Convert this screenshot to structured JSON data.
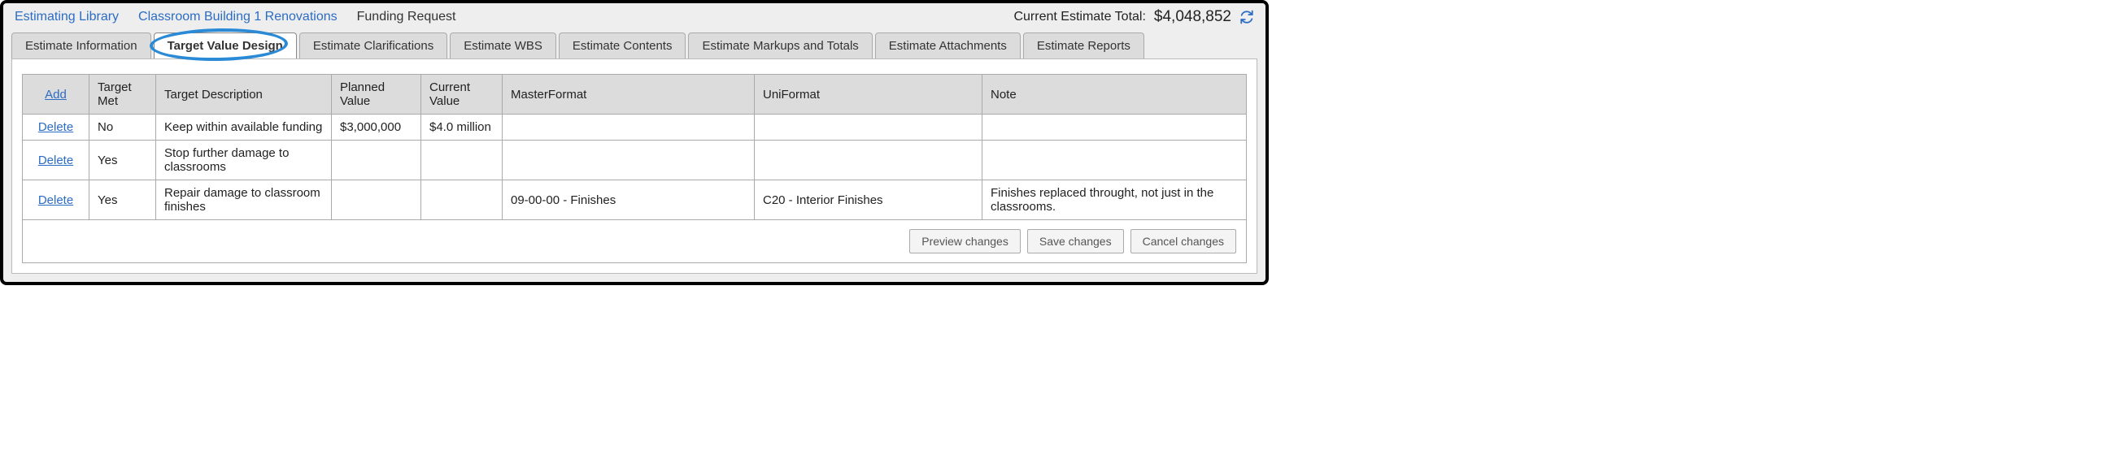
{
  "breadcrumbs": {
    "lib": "Estimating Library",
    "project": "Classroom Building 1 Renovations",
    "page": "Funding Request"
  },
  "total": {
    "label": "Current Estimate Total:",
    "value": "$4,048,852"
  },
  "tabs": [
    "Estimate Information",
    "Target Value Design",
    "Estimate Clarifications",
    "Estimate WBS",
    "Estimate Contents",
    "Estimate Markups and Totals",
    "Estimate Attachments",
    "Estimate Reports"
  ],
  "active_tab_index": 1,
  "table": {
    "headers": {
      "add": "Add",
      "target_met": "Target Met",
      "target_desc": "Target Description",
      "planned_value": "Planned Value",
      "current_value": "Current Value",
      "master": "MasterFormat",
      "uni": "UniFormat",
      "note": "Note"
    },
    "rows": [
      {
        "action": "Delete",
        "target_met": "No",
        "target_desc": "Keep within available funding",
        "planned_value": "$3,000,000",
        "current_value": "$4.0 million",
        "master": "",
        "uni": "",
        "note": ""
      },
      {
        "action": "Delete",
        "target_met": "Yes",
        "target_desc": "Stop further damage to classrooms",
        "planned_value": "",
        "current_value": "",
        "master": "",
        "uni": "",
        "note": ""
      },
      {
        "action": "Delete",
        "target_met": "Yes",
        "target_desc": "Repair damage to classroom finishes",
        "planned_value": "",
        "current_value": "",
        "master": "09-00-00 - Finishes",
        "uni": "C20 - Interior Finishes",
        "note": "Finishes replaced throught, not just in the classrooms."
      }
    ]
  },
  "footer": {
    "preview": "Preview changes",
    "save": "Save changes",
    "cancel": "Cancel changes"
  }
}
